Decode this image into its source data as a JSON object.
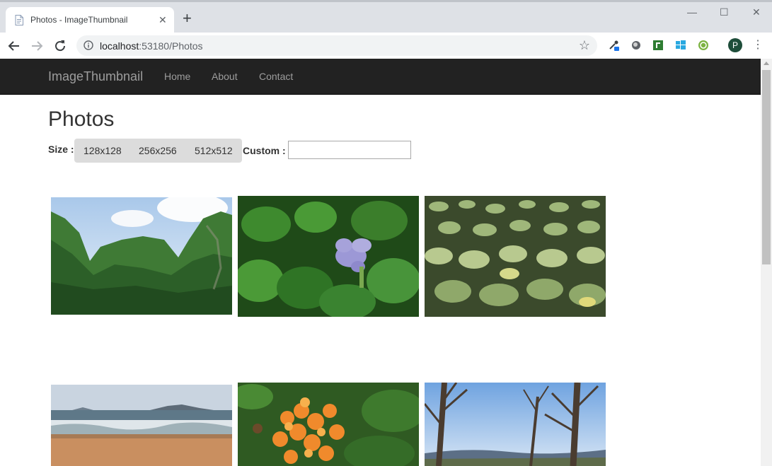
{
  "browser": {
    "tab_title": "Photos - ImageThumbnail",
    "tab_close": "✕",
    "new_tab": "+",
    "url_host": "localhost",
    "url_rest": ":53180/Photos",
    "avatar_initial": "P",
    "window_controls": {
      "minimize": "—",
      "maximize": "☐",
      "close": "✕"
    }
  },
  "navbar": {
    "brand": "ImageThumbnail",
    "links": [
      "Home",
      "About",
      "Contact"
    ]
  },
  "page": {
    "title": "Photos",
    "size_label": "Size :",
    "sizes": [
      "128x128",
      "256x256",
      "512x512"
    ],
    "custom_label": "Custom :",
    "custom_value": ""
  },
  "photos": [
    {
      "subject": "green karst mountains under blue sky"
    },
    {
      "subject": "purple water hyacinth flower among green leaves"
    },
    {
      "subject": "field of lotus leaves"
    },
    {
      "subject": "beach with waves and distant hills"
    },
    {
      "subject": "orange ixora flower cluster"
    },
    {
      "subject": "bare trees with blue sky and mountains"
    }
  ],
  "colors": {
    "navbar_bg": "#222222",
    "navbar_text": "#9d9d9d",
    "size_group_bg": "#dcdcdc"
  }
}
